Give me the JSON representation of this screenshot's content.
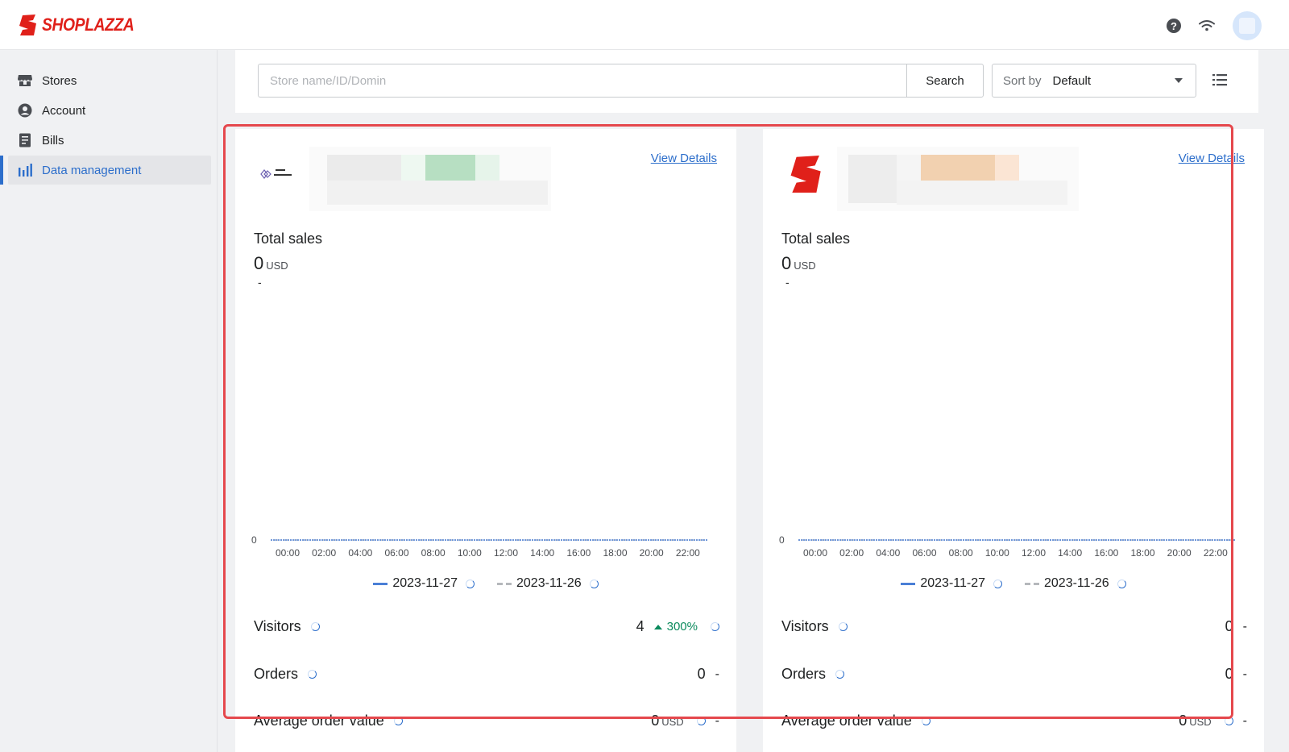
{
  "app": {
    "brand": "SHOPLAZZA",
    "brand_color": "#e0201a",
    "accent": "#2c6ecb"
  },
  "header": {
    "icons": [
      "help-icon",
      "wifi-icon",
      "avatar"
    ]
  },
  "sidebar": {
    "items": [
      {
        "label": "Stores",
        "icon": "store-icon",
        "active": false
      },
      {
        "label": "Account",
        "icon": "account-icon",
        "active": false
      },
      {
        "label": "Bills",
        "icon": "bills-icon",
        "active": false
      },
      {
        "label": "Data management",
        "icon": "bar-chart-icon",
        "active": true
      }
    ]
  },
  "search": {
    "placeholder": "Store name/ID/Domin",
    "value": "",
    "button": "Search"
  },
  "sort": {
    "label": "Sort by",
    "value": "Default"
  },
  "cards": [
    {
      "view_details": "View Details",
      "total_sales_label": "Total sales",
      "total_sales_value": "0",
      "currency": "USD",
      "total_sales_change": "-",
      "legend": [
        "2023-11-27",
        "2023-11-26"
      ],
      "metrics": {
        "visitors": {
          "label": "Visitors",
          "value": "4",
          "change": "300%"
        },
        "orders": {
          "label": "Orders",
          "value": "0",
          "change": "-"
        },
        "aov": {
          "label": "Average order value",
          "value": "0",
          "unit": "USD",
          "change": "-"
        }
      }
    },
    {
      "view_details": "View Details",
      "total_sales_label": "Total sales",
      "total_sales_value": "0",
      "currency": "USD",
      "total_sales_change": "-",
      "legend": [
        "2023-11-27",
        "2023-11-26"
      ],
      "metrics": {
        "visitors": {
          "label": "Visitors",
          "value": "0",
          "change": "-"
        },
        "orders": {
          "label": "Orders",
          "value": "0",
          "change": "-"
        },
        "aov": {
          "label": "Average order value",
          "value": "0",
          "unit": "USD",
          "change": "-"
        }
      }
    }
  ],
  "chart_data": [
    {
      "type": "line",
      "x": [
        "00:00",
        "02:00",
        "04:00",
        "06:00",
        "08:00",
        "10:00",
        "12:00",
        "14:00",
        "16:00",
        "18:00",
        "20:00",
        "22:00"
      ],
      "series": [
        {
          "name": "2023-11-27",
          "color": "#4a7fd6",
          "values": [
            0,
            0,
            0,
            0,
            0,
            0,
            0,
            0,
            0,
            0,
            0,
            0
          ]
        },
        {
          "name": "2023-11-26",
          "color": "#b5b8bc",
          "values": [
            0,
            0,
            0,
            0,
            0,
            0,
            0,
            0,
            0,
            0,
            0,
            0
          ]
        }
      ],
      "y_ticks": [
        "0"
      ]
    },
    {
      "type": "line",
      "x": [
        "00:00",
        "02:00",
        "04:00",
        "06:00",
        "08:00",
        "10:00",
        "12:00",
        "14:00",
        "16:00",
        "18:00",
        "20:00",
        "22:00"
      ],
      "series": [
        {
          "name": "2023-11-27",
          "color": "#4a7fd6",
          "values": [
            0,
            0,
            0,
            0,
            0,
            0,
            0,
            0,
            0,
            0,
            0,
            0
          ]
        },
        {
          "name": "2023-11-26",
          "color": "#b5b8bc",
          "values": [
            0,
            0,
            0,
            0,
            0,
            0,
            0,
            0,
            0,
            0,
            0,
            0
          ]
        }
      ],
      "y_ticks": [
        "0"
      ]
    }
  ]
}
